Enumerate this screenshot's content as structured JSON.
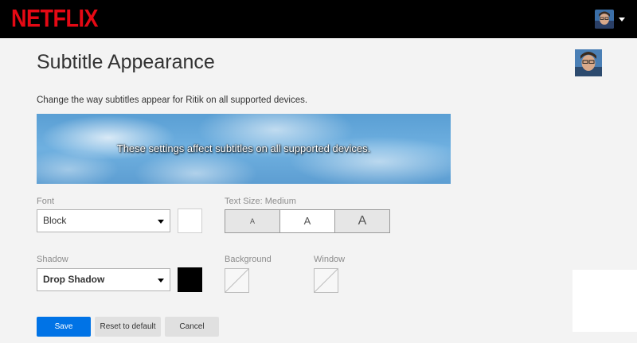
{
  "header": {
    "logo_text": "NETFLIX",
    "brand_color": "#e50914",
    "profile_menu_icon": "avatar-icon"
  },
  "page": {
    "title": "Subtitle Appearance",
    "description": "Change the way subtitles appear for Ritik on all supported devices."
  },
  "preview": {
    "text": "These settings affect subtitles on all supported devices."
  },
  "font": {
    "label": "Font",
    "value": "Block",
    "color": "#ffffff"
  },
  "text_size": {
    "label": "Text Size: Medium",
    "options": [
      "A",
      "A",
      "A"
    ],
    "selected_index": 1
  },
  "shadow": {
    "label": "Shadow",
    "value": "Drop Shadow",
    "color": "#000000"
  },
  "background": {
    "label": "Background"
  },
  "window": {
    "label": "Window"
  },
  "buttons": {
    "save": "Save",
    "reset": "Reset to default",
    "cancel": "Cancel"
  },
  "colors": {
    "save_button": "#0073e6",
    "topbar": "#000000"
  }
}
